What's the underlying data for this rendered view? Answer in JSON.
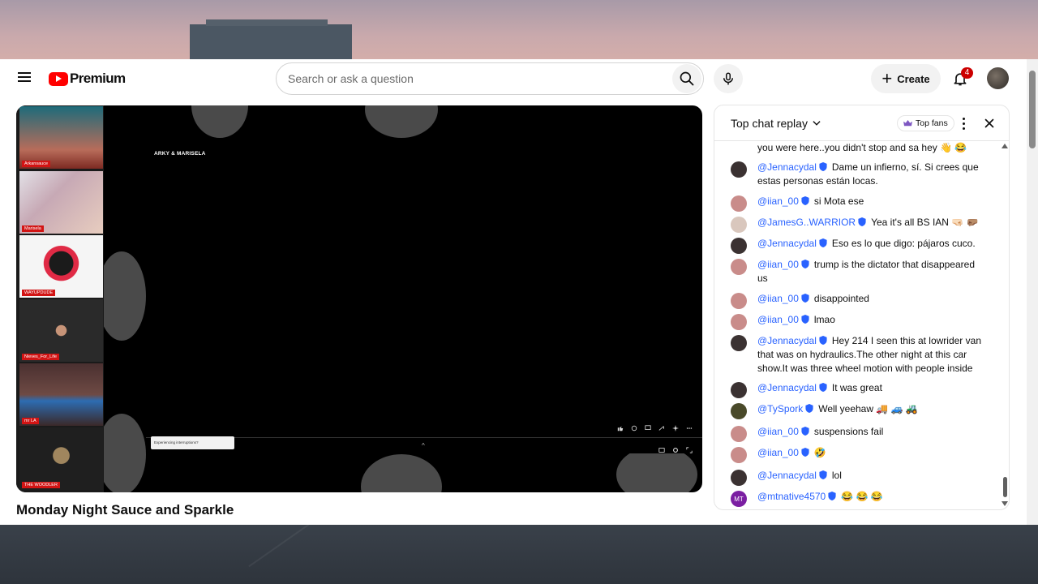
{
  "header": {
    "brand": "Premium",
    "search_placeholder": "Search or ask a question",
    "create_label": "Create",
    "notification_count": "4"
  },
  "player": {
    "stage_title": "ARKY & MARISELA",
    "toast_text": "Experiencing interruptions?",
    "cams": [
      {
        "label": "Arkansauce"
      },
      {
        "label": "Marisela"
      },
      {
        "label": "WAYUPDUDE"
      },
      {
        "label": "Nieves_For_Life"
      },
      {
        "label": "mr LA"
      },
      {
        "label": "THE WOODLER"
      }
    ]
  },
  "video": {
    "title": "Monday Night Sauce and Sparkle"
  },
  "chat": {
    "mode": "Top chat replay",
    "top_fans": "Top fans",
    "messages": [
      {
        "author": "",
        "text": "you were here..you didn't stop and sa hey 👋 😂",
        "avatar_color": "#ffffff"
      },
      {
        "author": "@Jennacydal",
        "text": "Dame un infierno, sí. Si crees que estas personas están locas.",
        "avatar_color": "#3b3232"
      },
      {
        "author": "@iian_00",
        "text": "si Mota ese",
        "avatar_color": "#c98c8a"
      },
      {
        "author": "@JamesG..WARRIOR",
        "text": "Yea it's all BS IAN 🤜🏻 🤛🏽",
        "avatar_color": "#d9c7bd"
      },
      {
        "author": "@Jennacydal",
        "text": "Eso es lo que digo: pájaros cuco.",
        "avatar_color": "#3b3232"
      },
      {
        "author": "@iian_00",
        "text": "trump is the dictator that disappeared us",
        "avatar_color": "#c98c8a"
      },
      {
        "author": "@iian_00",
        "text": "disappointed",
        "avatar_color": "#c98c8a"
      },
      {
        "author": "@iian_00",
        "text": "lmao",
        "avatar_color": "#c98c8a"
      },
      {
        "author": "@Jennacydal",
        "text": "Hey 214 I seen this at lowrider van that was on hydraulics.The other night at this car show.It was three wheel motion with people inside",
        "avatar_color": "#3b3232"
      },
      {
        "author": "@Jennacydal",
        "text": "It was great",
        "avatar_color": "#3b3232"
      },
      {
        "author": "@TySpork",
        "text": "Well yeehaw 🚚 🚙 🚜",
        "avatar_color": "#4a4a2a"
      },
      {
        "author": "@iian_00",
        "text": "suspensions fail",
        "avatar_color": "#c98c8a"
      },
      {
        "author": "@iian_00",
        "text": "🤣",
        "avatar_color": "#c98c8a"
      },
      {
        "author": "@Jennacydal",
        "text": "lol",
        "avatar_color": "#3b3232"
      },
      {
        "author": "@mtnative4570",
        "text": "😂 😂 😂",
        "avatar_color": "#7b1fa2",
        "avatar_initials": "MT"
      }
    ]
  },
  "colors": {
    "brand_red": "#ff0000",
    "author_blue": "#2962ff",
    "cam_label_red": "#d21414"
  },
  "icons": [
    "menu-icon",
    "youtube-logo-icon",
    "search-icon",
    "mic-icon",
    "plus-icon",
    "bell-icon",
    "chevron-down-icon",
    "crown-icon",
    "more-vert-icon",
    "close-icon",
    "verified-icon"
  ]
}
